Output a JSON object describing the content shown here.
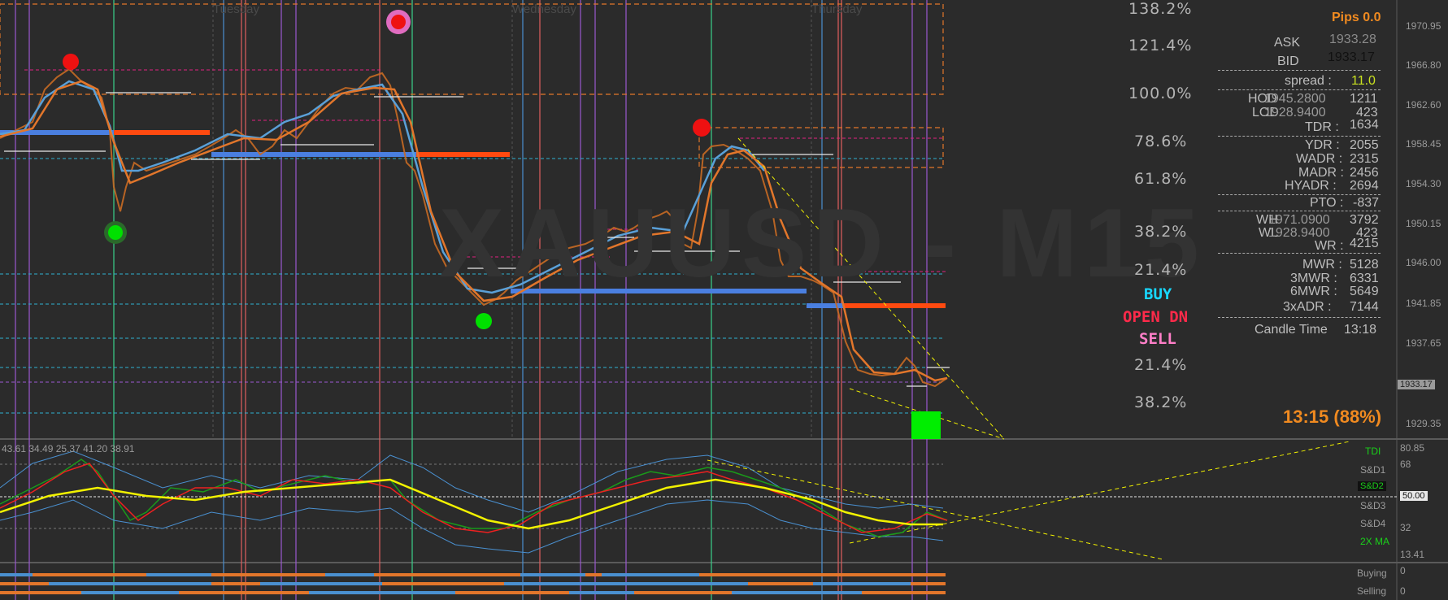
{
  "days": [
    "Tuesday",
    "Wednesday",
    "Thursday"
  ],
  "fib_levels": [
    "138.2%",
    "121.4%",
    "100.0%",
    "78.6%",
    "61.8%",
    "38.2%",
    "21.4%",
    "21.4%",
    "38.2%"
  ],
  "watermark": "XAUUSD - M15",
  "signals": {
    "buy": "BUY",
    "open": "OPEN DN",
    "sell": "SELL"
  },
  "panel": {
    "pips": "Pips 0.0",
    "ask_label": "ASK",
    "ask_value": "1933.28",
    "bid_label": "BID",
    "bid_value": "1933.17",
    "spread_label": "spread :",
    "spread_value": "11.0",
    "hod_label": "HOD",
    "hod_price": "1945.2800",
    "hod_value": "1211",
    "lod_label": "LOD",
    "lod_price": "1928.9400",
    "lod_value": "423",
    "rows": [
      {
        "label": "TDR :",
        "value": "1634"
      },
      {
        "label": "YDR :",
        "value": "2055"
      },
      {
        "label": "WADR :",
        "value": "2315"
      },
      {
        "label": "MADR :",
        "value": "2456"
      },
      {
        "label": "HYADR :",
        "value": "2694"
      },
      {
        "label": "PTO :",
        "value": "-837"
      },
      {
        "label": "WH",
        "price": "1971.0900",
        "value": "3792"
      },
      {
        "label": "WL",
        "price": "1928.9400",
        "value": "423"
      },
      {
        "label": "WR :",
        "value": "4215"
      },
      {
        "label": "MWR :",
        "value": "5128"
      },
      {
        "label": "3MWR :",
        "value": "6331"
      },
      {
        "label": "6MWR :",
        "value": "5649"
      },
      {
        "label": "3xADR :",
        "value": "7144"
      }
    ],
    "candle_time_label": "Candle Time",
    "candle_time_value": "13:18",
    "timer": "13:15 (88%)"
  },
  "price_axis": [
    "1970.95",
    "1966.80",
    "1962.60",
    "1958.45",
    "1954.30",
    "1950.15",
    "1946.00",
    "1941.85",
    "1937.65",
    "1933.17",
    "1929.35"
  ],
  "current_price": "1933.17",
  "indicator": {
    "values_text": "43.61 34.49 25.37 41.20 38.91",
    "axis": [
      "80.85",
      "68",
      "50.00",
      "32",
      "13.41"
    ],
    "labels": [
      "TDI",
      "S&D1",
      "S&D2",
      "S&D3",
      "S&D4",
      "2X MA"
    ]
  },
  "bottom": {
    "buying": "Buying",
    "selling": "Selling",
    "zero1": "0",
    "zero2": "0"
  },
  "colors": {
    "orange": "#e2762b",
    "blue": "#4a90d0",
    "red": "#ff1a1a",
    "green": "#00d000",
    "yellow": "#f2f200",
    "sell_pink": "#ff7fc8",
    "buy_cyan": "#18d8ff",
    "open_red": "#ff2a4a"
  }
}
